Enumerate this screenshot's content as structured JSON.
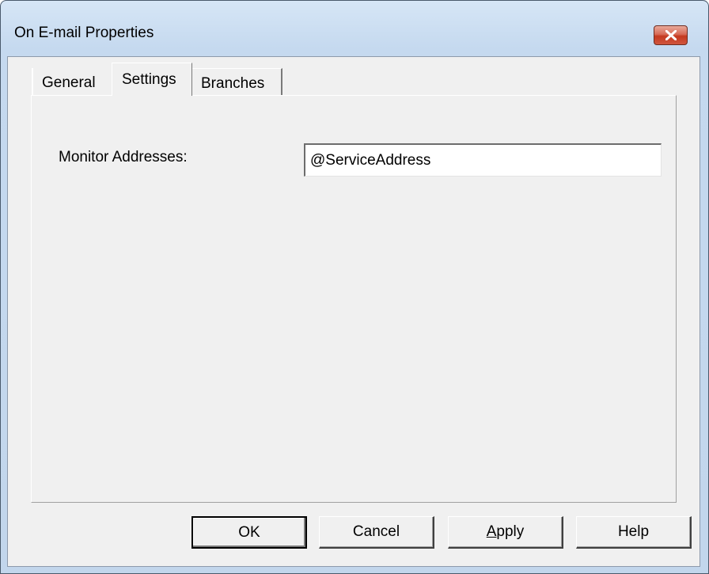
{
  "window": {
    "title": "On E-mail Properties"
  },
  "tabs": [
    {
      "label": "General"
    },
    {
      "label": "Settings"
    },
    {
      "label": "Branches"
    }
  ],
  "active_tab": "Settings",
  "settings": {
    "monitor_label": "Monitor Addresses:",
    "monitor_value": "@ServiceAddress"
  },
  "buttons": {
    "ok": "OK",
    "cancel": "Cancel",
    "apply_mnemonic": "A",
    "apply_rest": "pply",
    "help": "Help"
  },
  "icons": {
    "close": "close-icon"
  }
}
